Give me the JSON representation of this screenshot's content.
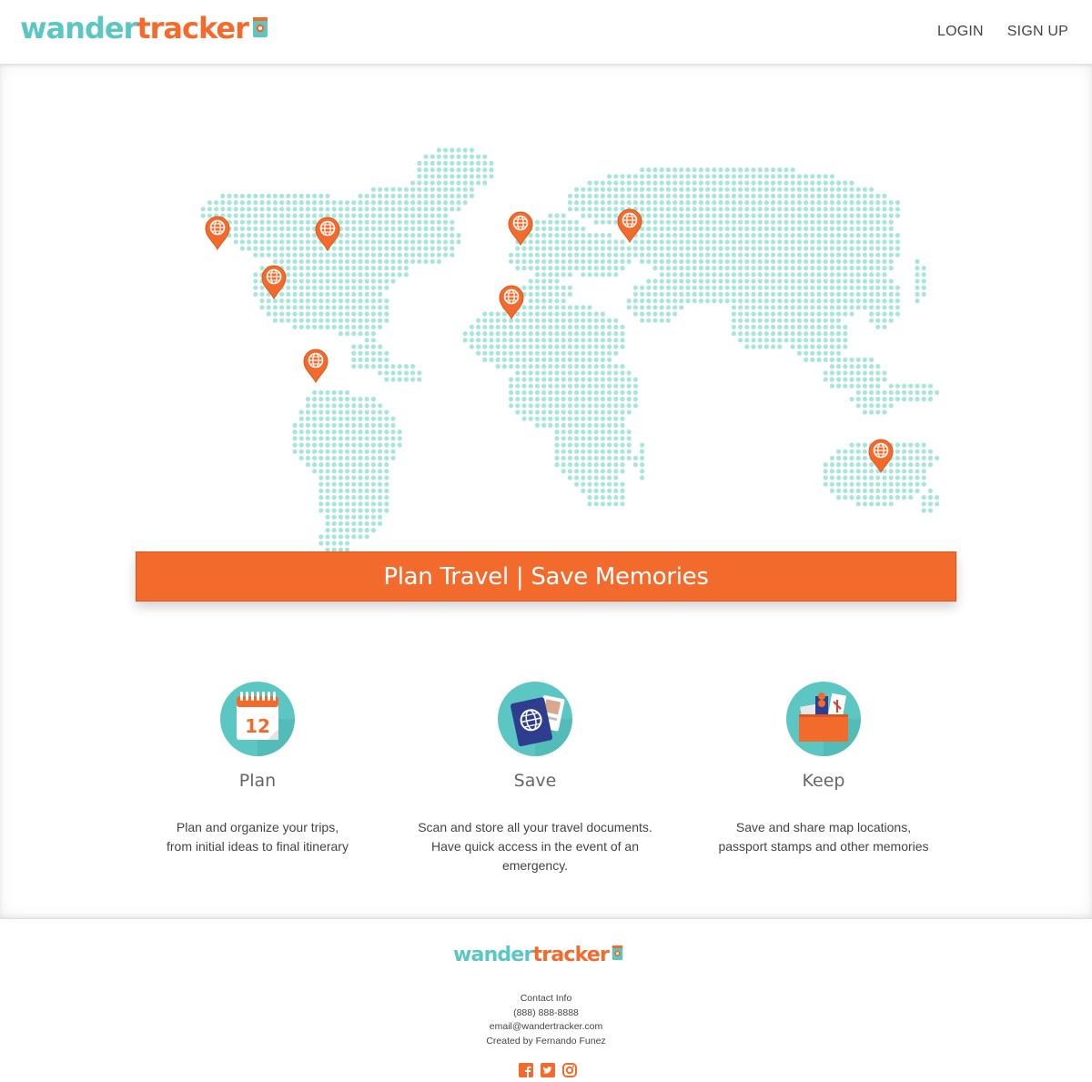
{
  "header": {
    "logo_part1": "wander",
    "logo_part2": "tracker",
    "nav": {
      "login": "LOGIN",
      "signup": "SIGN UP"
    }
  },
  "hero": {
    "banner_text": "Plan Travel | Save Memories"
  },
  "features": [
    {
      "icon": "calendar-icon",
      "calendar_number": "12",
      "title": "Plan",
      "line1": "Plan and organize your trips,",
      "line2": "from initial ideas to final itinerary"
    },
    {
      "icon": "passport-icon",
      "title": "Save",
      "line1": "Scan and store all your travel documents.",
      "line2": "Have quick access in the event of an emergency."
    },
    {
      "icon": "folder-icon",
      "title": "Keep",
      "line1": "Save and share map locations,",
      "line2": "passport stamps and other memories"
    }
  ],
  "footer": {
    "logo_part1": "wander",
    "logo_part2": "tracker",
    "contact_title": "Contact Info",
    "phone": "(888) 888-8888",
    "email": "email@wandertracker.com",
    "credit": "Created by Fernando Funez",
    "social": [
      "facebook-icon",
      "twitter-icon",
      "instagram-icon"
    ]
  },
  "colors": {
    "teal": "#5cc6c3",
    "orange": "#f26b2d",
    "dot": "#a8e6dc"
  }
}
